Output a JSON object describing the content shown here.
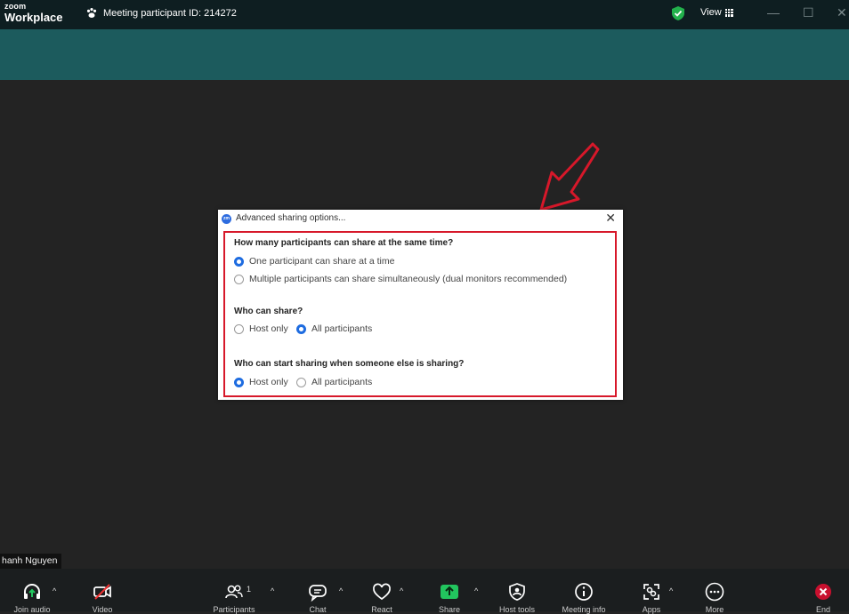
{
  "titlebar": {
    "brand_small": "zoom",
    "brand_big": "Workplace",
    "meeting_id": "Meeting participant ID: 214272",
    "view_label": "View",
    "minimize": "—",
    "maximize": "☐",
    "close": "✕"
  },
  "dialog": {
    "title": "Advanced sharing options...",
    "logo_text": "zm",
    "close": "✕",
    "q1": "How many participants can share at the same time?",
    "q1_opt1": "One participant can share at a time",
    "q1_opt2": "Multiple participants can share simultaneously (dual monitors recommended)",
    "q2": "Who can share?",
    "q2_opt1": "Host only",
    "q2_opt2": "All participants",
    "q3": "Who can start sharing when someone else is sharing?",
    "q3_opt1": "Host only",
    "q3_opt2": "All participants",
    "selected": {
      "q1": "One participant can share at a time",
      "q2": "All participants",
      "q3": "Host only"
    }
  },
  "nametag": "hanh Nguyen",
  "toolbar": {
    "join_audio": "Join audio",
    "video": "Video",
    "participants": "Participants",
    "participants_count": "1",
    "chat": "Chat",
    "react": "React",
    "share": "Share",
    "host_tools": "Host tools",
    "meeting_info": "Meeting info",
    "apps": "Apps",
    "more": "More",
    "end": "End"
  },
  "colors": {
    "titlebar": "#0e1e21",
    "band": "#1c5b5d",
    "background": "#232323",
    "highlight": "#d7182a",
    "radio": "#1e6ce0",
    "share_green": "#22c55e"
  }
}
